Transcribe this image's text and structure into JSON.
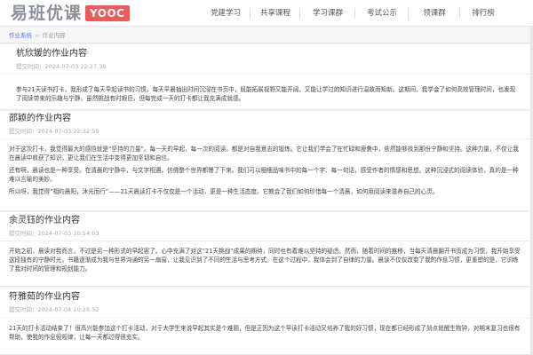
{
  "header": {
    "logo_text": "易班优课",
    "logo_badge": "YOOC",
    "nav": [
      "党建学习",
      "共享课程",
      "学习课群",
      "考试公示",
      "领课群",
      "排行榜"
    ]
  },
  "breadcrumb": {
    "root": "作业系统",
    "sep": ">",
    "current": "作业内容"
  },
  "posts": [
    {
      "title": "杭欣媛的作业内容",
      "time": "提交时间：2024-07-03 22:27:39",
      "paragraphs": [
        "参与21天读书打卡，我形成了每天早起读书的习惯。每天早晨抽出时间沉浸在书页中，既能拓展视野又能开阔，又能让学过的知识进行温故而知新。这期间，我学会了如何高效管理时间，也发现了阅读带来的乐趣与宁静。虽然挑战有时艰巨，但每完成一天的打卡都让我充满成就感。"
      ]
    },
    {
      "title": "邵颖的作业内容",
      "time": "提交时间：2024-07-03 22:32:59",
      "paragraphs": [
        "对于这次打卡，我觉得最大的感悟就是“坚持的力量”。每一天的早起，每一次的阅读，都是对自我意志的锻炼。它让我们学会了在忙碌和疲惫中，依然能够找到那份宁静和坚持。这种力量，不仅让我在晨读中收获了知识，更让我们在生活中变得更加坚韧和自信。",
        "还有啊，晨读也是一种享受。在清晨的宁静中，与文字相遇，仿佛整个世界都慢了下来。我们可以细细品味书中的每一个字、每一句话，感受作者的情感和思想。这种沉浸式的阅读体验，真的是一种难以言喻的美妙。",
        "所以呀，我觉得“相约晨阳，沐光而行”——21天晨读打卡不仅仅是一个活动，更是一种生活态度。它教会了我们如何珍惜每一个清晨，如何用阅读来滋养自己的心灵。"
      ]
    },
    {
      "title": "余灵钰的作业内容",
      "time": "提交时间：2024-07-03 20:54:03",
      "paragraphs": [
        "开始之初，晨读对我而言，不过是另一种形式的早起罢了。心中充满了对这“21天挑战”成果的期待，同时也有着难以坚持的疑虑。然而，随着时间的推移，当每天清晨翻开书页成为习惯，我开始享受这段独有的宁静时光，书籍逐渐成为我与世界沟通的另一扇窗，让我见识到了不同的生活与思考方式。在这个过程中，我体会到了自律的力量。晨读不仅仅改变了我的作息习惯，更重塑的是，它训练了我对时间的管理和规划能力。"
      ]
    },
    {
      "title": "符雅茹的作业内容",
      "time": "提交时间：2024-07-04 10:26:52",
      "paragraphs": [
        "21天的打卡活动结束了！很高兴能参加这个打卡活动，对于大学生来说早起其实是个难题，但是正因为这个早读打卡活动又培养了我的好习惯，现在都已经形成了到点就醒生物钟，对期末复习也很有帮助，使我的作息很规律，让每一天都过得很充实。"
      ]
    }
  ]
}
